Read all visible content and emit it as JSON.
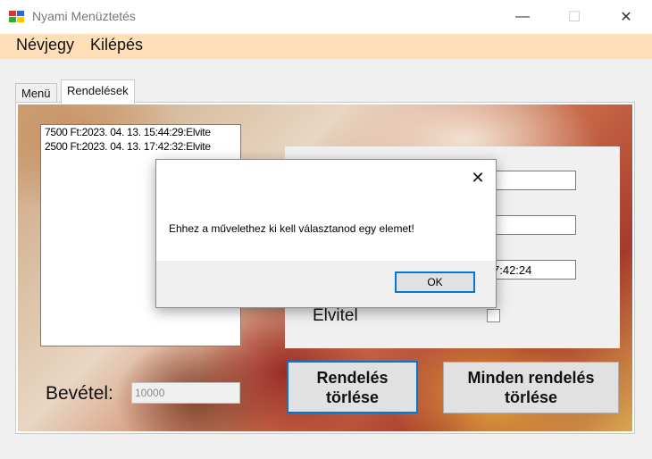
{
  "window": {
    "title": "Nyami Menüztetés",
    "minimize_glyph": "—",
    "maximize_glyph": "☐",
    "close_glyph": "✕"
  },
  "menu": {
    "about_label": "Névjegy",
    "exit_label": "Kilépés"
  },
  "tabs": [
    {
      "label": "Menü"
    },
    {
      "label": "Rendelések"
    }
  ],
  "orders": {
    "items": [
      "7500 Ft:2023. 04. 13. 15:44:29:Elvite",
      "2500 Ft:2023. 04. 13. 17:42:32:Elvite"
    ]
  },
  "details": {
    "field1_value": "",
    "field2_value": "",
    "date_value": "7:42:24",
    "takeaway_label": "Elvitel",
    "takeaway_checked": false
  },
  "income": {
    "label": "Bevétel:",
    "value": "10000"
  },
  "buttons": {
    "delete_order": "Rendelés törlése",
    "delete_all": "Minden rendelés törlése"
  },
  "dialog": {
    "message": "Ehhez a művelethez ki kell választanod egy elemet!",
    "ok_label": "OK",
    "close_glyph": "✕"
  },
  "colors": {
    "menubar": "#ffdfb8",
    "focus_border": "#0078d7"
  }
}
